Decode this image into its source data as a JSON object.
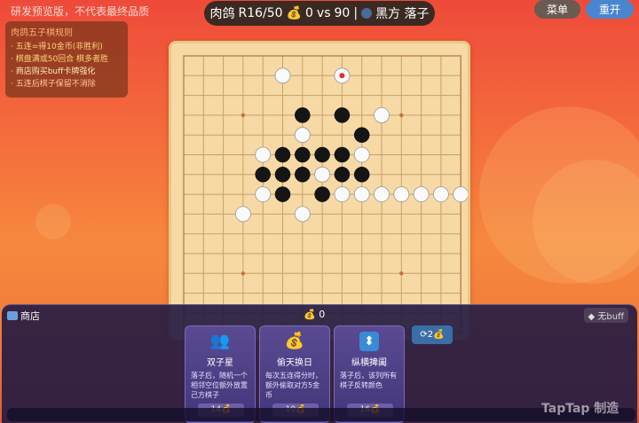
{
  "watermark_top": "研发预览版，不代表最终品质",
  "status": {
    "prefix": "肉鸽",
    "round": "R16/50",
    "gold_icon": "💰",
    "score_left": "0",
    "vs": "vs",
    "score_right": "90",
    "sep": "|",
    "turn_text": "黑方 落子"
  },
  "buttons": {
    "menu": "菜单",
    "restart": "重开"
  },
  "rules": {
    "title": "肉鸽五子棋规则",
    "lines": [
      "· 五连=得10金币(非胜利)",
      "· 棋盘满或50回合 棋多者胜",
      "· 商店购买buff卡牌强化",
      "· 五连后棋子保留不消除"
    ]
  },
  "board": {
    "size": 15,
    "last_move": [
      8,
      1
    ],
    "stones_black": [
      [
        6,
        3
      ],
      [
        8,
        3
      ],
      [
        6,
        4
      ],
      [
        9,
        4
      ],
      [
        5,
        5
      ],
      [
        6,
        5
      ],
      [
        7,
        5
      ],
      [
        8,
        5
      ],
      [
        4,
        6
      ],
      [
        5,
        6
      ],
      [
        6,
        6
      ],
      [
        8,
        6
      ],
      [
        9,
        6
      ],
      [
        5,
        7
      ],
      [
        7,
        7
      ]
    ],
    "stones_white": [
      [
        5,
        1
      ],
      [
        8,
        1
      ],
      [
        10,
        3
      ],
      [
        6,
        4
      ],
      [
        4,
        5
      ],
      [
        9,
        5
      ],
      [
        7,
        6
      ],
      [
        4,
        7
      ],
      [
        8,
        7
      ],
      [
        9,
        7
      ],
      [
        10,
        7
      ],
      [
        11,
        7
      ],
      [
        12,
        7
      ],
      [
        13,
        7
      ],
      [
        14,
        7
      ],
      [
        3,
        8
      ],
      [
        6,
        8
      ]
    ],
    "star_points": [
      [
        3,
        3
      ],
      [
        11,
        3
      ],
      [
        7,
        7
      ],
      [
        3,
        11
      ],
      [
        11,
        11
      ]
    ]
  },
  "shop": {
    "title": "商店",
    "gold": "0",
    "buff": "无buff",
    "refresh": "2",
    "cards": [
      {
        "icon": "双人-icon",
        "name": "双子星",
        "desc": "落子后，随机一个相邻空位额外放置己方棋子",
        "price": "14"
      },
      {
        "icon": "钱袋-icon",
        "name": "偷天换日",
        "desc": "每次五连得分时，额外偷取对方5金币",
        "price": "10"
      },
      {
        "icon": "箭头-icon",
        "name": "纵横捭阖",
        "desc": "落子后，该列所有棋子反转颜色",
        "price": "16"
      }
    ]
  },
  "logo": "TapTap 制造"
}
